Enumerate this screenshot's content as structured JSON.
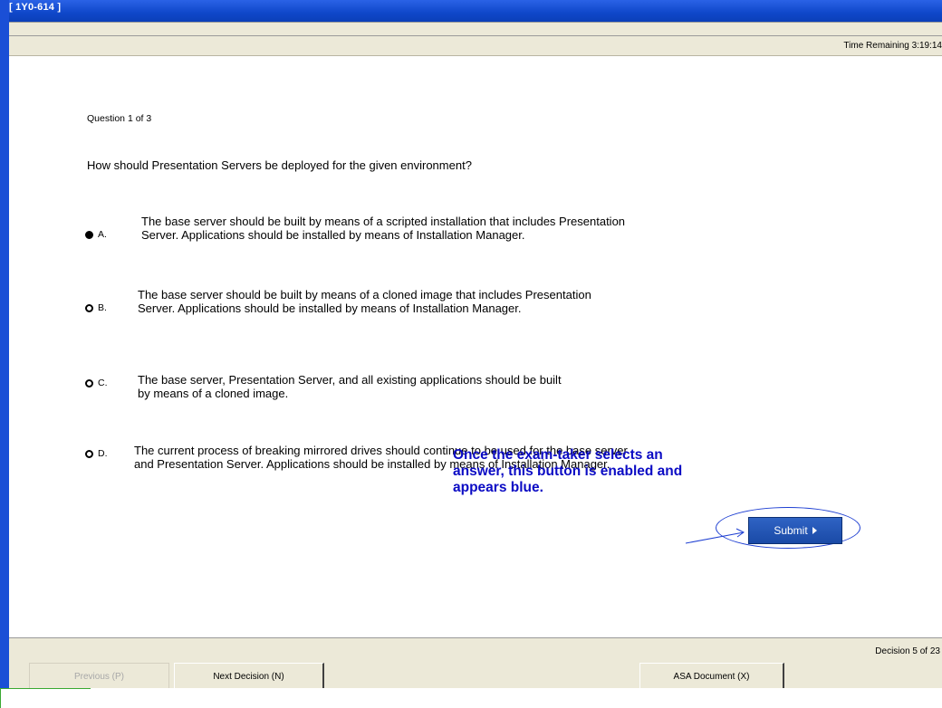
{
  "window": {
    "title": "[ 1Y0-614 ]"
  },
  "header": {
    "time_remaining": "Time Remaining 3:19:14"
  },
  "question": {
    "number_text": "Question 1 of 3",
    "text": "How should Presentation Servers be deployed for the given environment?",
    "options": [
      {
        "letter": "A.",
        "selected": true,
        "text": "The base server should be built by means of a scripted installation that includes Presentation Server. Applications should be installed by means of Installation Manager."
      },
      {
        "letter": "B.",
        "selected": false,
        "text": "The base server should be built by means of a cloned image that includes Presentation Server. Applications should be installed by means of Installation Manager."
      },
      {
        "letter": "C.",
        "selected": false,
        "text": "The base server, Presentation Server, and all existing applications should be built by means of a cloned image."
      },
      {
        "letter": "D.",
        "selected": false,
        "text": "The current process of breaking mirrored drives should continue to be used for the base server and Presentation Server. Applications should be installed by means of Installation Manager."
      }
    ]
  },
  "callout": {
    "text": "Once the exam-taker selects an answer, this button is enabled and appears blue.",
    "color": "#0b0bc4"
  },
  "submit": {
    "label": "Submit",
    "color": "#1f4fb0"
  },
  "footer": {
    "decision_text": "Decision 5 of 23",
    "previous_label": "Previous (P)",
    "next_label": "Next Decision (N)",
    "asa_label": "ASA Document (X)"
  }
}
